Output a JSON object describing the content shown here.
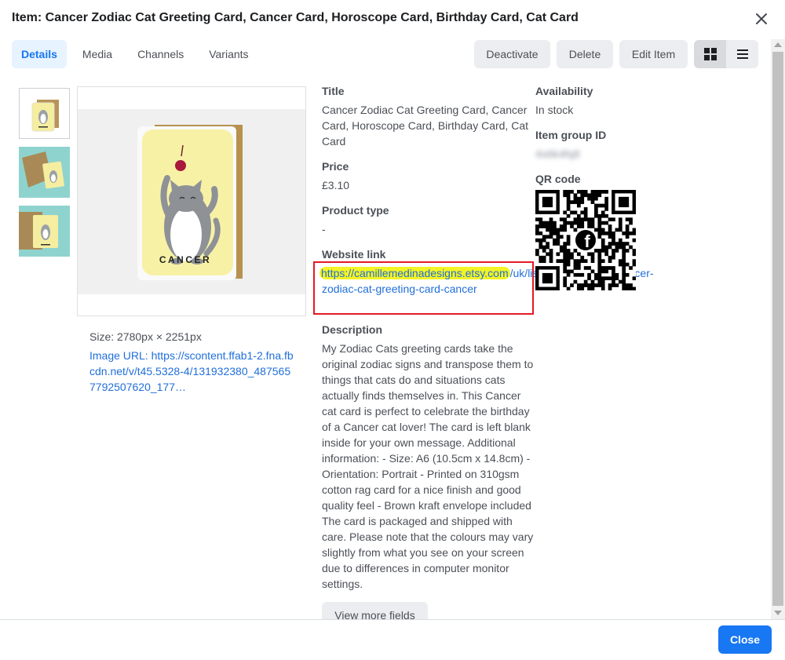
{
  "dialog": {
    "title": "Item: Cancer Zodiac Cat Greeting Card, Cancer Card, Horoscope Card, Birthday Card, Cat Card"
  },
  "tabs": [
    {
      "label": "Details",
      "active": true
    },
    {
      "label": "Media",
      "active": false
    },
    {
      "label": "Channels",
      "active": false
    },
    {
      "label": "Variants",
      "active": false
    }
  ],
  "actions": {
    "deactivate": "Deactivate",
    "delete": "Delete",
    "edit": "Edit Item",
    "view_mode": "grid"
  },
  "image": {
    "card_text": "CANCER",
    "size": "Size: 2780px × 2251px",
    "url": "Image URL: https://scontent.ffab1-2.fna.fbcdn.net/v/t45.5328-4/131932380_4875657792507620_177…"
  },
  "details": {
    "title_label": "Title",
    "title_value": "Cancer Zodiac Cat Greeting Card, Cancer Card, Horoscope Card, Birthday Card, Cat Card",
    "price_label": "Price",
    "price_value": "£3.10",
    "product_type_label": "Product type",
    "product_type_value": "-",
    "website_link_label": "Website link",
    "website_link_highlighted": "https://camillemedinadesigns.etsy.com",
    "website_link_rest": "/uk/listing/822382441/cancer-zodiac-cat-greeting-card-cancer",
    "description_label": "Description",
    "description_value": "My Zodiac Cats greeting cards take the original zodiac signs and transpose them to things that cats do and situations cats actually finds themselves in. This Cancer cat card is perfect to celebrate the birthday of a Cancer cat lover! The card is left blank inside for your own message. Additional information: - Size: A6 (10.5cm x 14.8cm) - Orientation: Portrait - Printed on 310gsm cotton rag card for a nice finish and good quality feel - Brown kraft envelope included The card is packaged and shipped with care. Please note that the colours may vary slightly from what you see on your screen due to differences in computer monitor settings.",
    "availability_label": "Availability",
    "availability_value": "In stock",
    "item_group_label": "Item group ID",
    "item_group_value": "4s6k4fq8",
    "qr_label": "QR code"
  },
  "buttons": {
    "view_more": "View more fields",
    "close": "Close"
  },
  "colors": {
    "primary": "#1877f2",
    "link": "#216fdb",
    "highlight_box": "#e31b23",
    "highlight_marker": "#f3f325",
    "tab_active_bg": "#e7f3ff"
  },
  "icons": [
    "close-icon",
    "grid-view-icon",
    "list-view-icon",
    "facebook-logo-icon"
  ]
}
